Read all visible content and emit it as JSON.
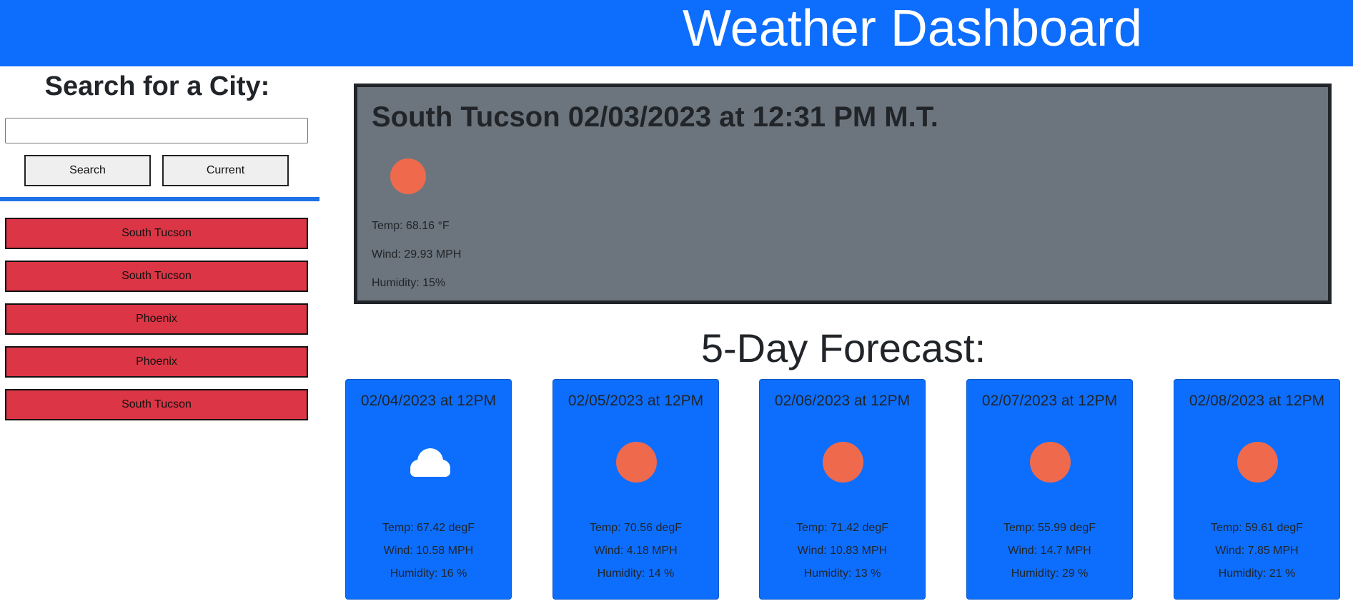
{
  "header": {
    "title": "Weather Dashboard"
  },
  "search": {
    "heading": "Search for a City:",
    "input_value": "",
    "search_label": "Search",
    "current_label": "Current"
  },
  "history": [
    "South Tucson",
    "South Tucson",
    "Phoenix",
    "Phoenix",
    "South Tucson"
  ],
  "current": {
    "title": "South Tucson 02/03/2023 at 12:31 PM M.T.",
    "icon": "sun-icon",
    "temp": "Temp: 68.16 °F",
    "wind": "Wind: 29.93 MPH",
    "humidity": "Humidity: 15%"
  },
  "forecast": {
    "heading": "5-Day Forecast:",
    "days": [
      {
        "date": "02/04/2023 at 12PM",
        "icon": "cloud-icon",
        "temp": "Temp: 67.42 degF",
        "wind": "Wind: 10.58 MPH",
        "humidity": "Humidity: 16 %"
      },
      {
        "date": "02/05/2023 at 12PM",
        "icon": "sun-icon",
        "temp": "Temp: 70.56 degF",
        "wind": "Wind: 4.18 MPH",
        "humidity": "Humidity: 14 %"
      },
      {
        "date": "02/06/2023 at 12PM",
        "icon": "sun-icon",
        "temp": "Temp: 71.42 degF",
        "wind": "Wind: 10.83 MPH",
        "humidity": "Humidity: 13 %"
      },
      {
        "date": "02/07/2023 at 12PM",
        "icon": "sun-icon",
        "temp": "Temp: 55.99 degF",
        "wind": "Wind: 14.7 MPH",
        "humidity": "Humidity: 29 %"
      },
      {
        "date": "02/08/2023 at 12PM",
        "icon": "sun-icon",
        "temp": "Temp: 59.61 degF",
        "wind": "Wind: 7.85 MPH",
        "humidity": "Humidity: 21 %"
      }
    ]
  },
  "colors": {
    "header": "#0d6efd",
    "history_button": "#dc3545",
    "current_card": "#6c757d",
    "forecast_card": "#0d6efd",
    "sun": "#ef6a4c"
  }
}
